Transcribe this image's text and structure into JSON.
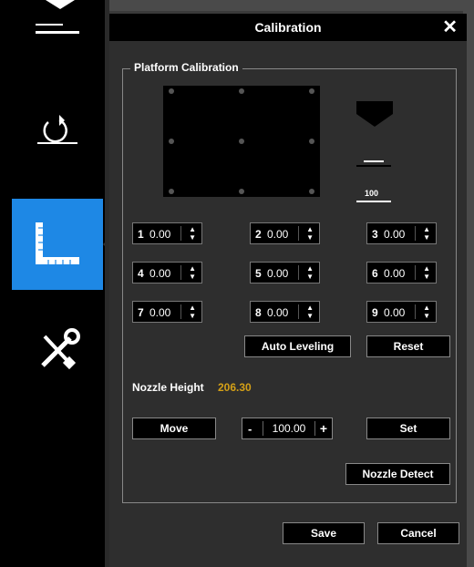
{
  "dialog": {
    "title": "Calibration",
    "close_label": "✕"
  },
  "platform": {
    "group_title": "Platform Calibration",
    "gauge_value": "100"
  },
  "points": [
    {
      "index": "1",
      "value": "0.00"
    },
    {
      "index": "2",
      "value": "0.00"
    },
    {
      "index": "3",
      "value": "0.00"
    },
    {
      "index": "4",
      "value": "0.00"
    },
    {
      "index": "5",
      "value": "0.00"
    },
    {
      "index": "6",
      "value": "0.00"
    },
    {
      "index": "7",
      "value": "0.00"
    },
    {
      "index": "8",
      "value": "0.00"
    },
    {
      "index": "9",
      "value": "0.00"
    }
  ],
  "buttons": {
    "auto_leveling": "Auto Leveling",
    "reset": "Reset",
    "move": "Move",
    "set": "Set",
    "nozzle_detect": "Nozzle Detect",
    "save": "Save",
    "cancel": "Cancel"
  },
  "nozzle": {
    "label": "Nozzle Height",
    "value": "206.30"
  },
  "stepper": {
    "minus": "-",
    "value": "100.00",
    "plus": "+"
  },
  "colors": {
    "accent": "#1e88e5",
    "nozzle_value": "#d4a017"
  },
  "sidebar": {
    "items": [
      "menu",
      "undo",
      "calibration",
      "tools"
    ],
    "active": "calibration"
  }
}
